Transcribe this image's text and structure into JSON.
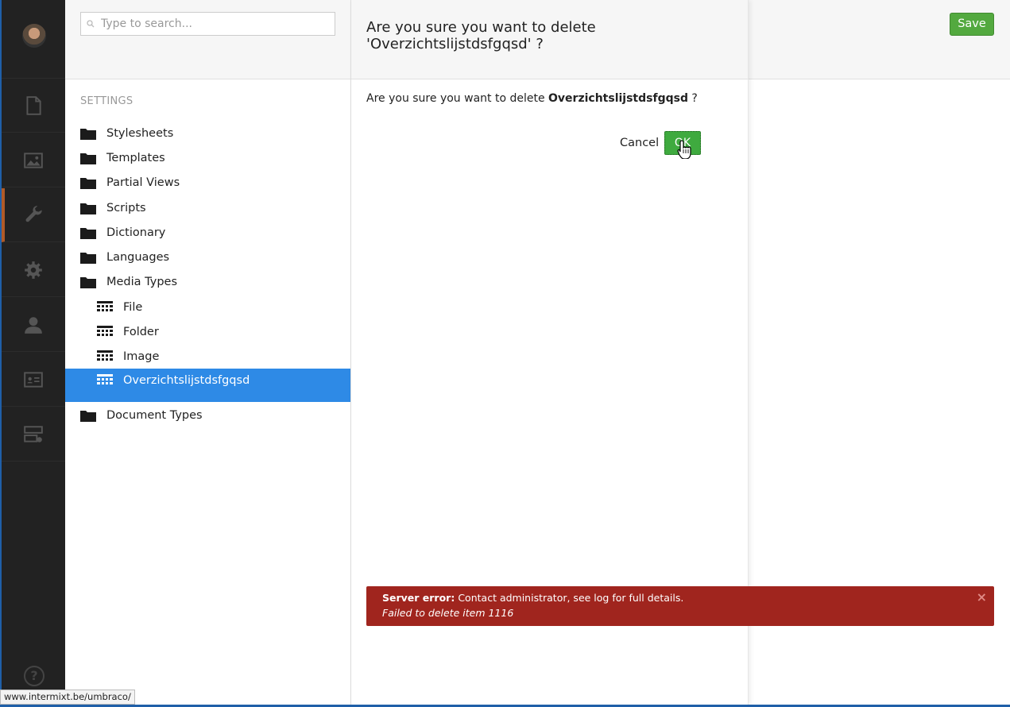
{
  "search": {
    "placeholder": "Type to search..."
  },
  "tree": {
    "section_label": "SETTINGS",
    "items": [
      {
        "label": "Stylesheets",
        "icon": "folder-icon"
      },
      {
        "label": "Templates",
        "icon": "folder-icon"
      },
      {
        "label": "Partial Views",
        "icon": "folder-icon"
      },
      {
        "label": "Scripts",
        "icon": "folder-icon"
      },
      {
        "label": "Dictionary",
        "icon": "folder-icon"
      },
      {
        "label": "Languages",
        "icon": "folder-icon"
      },
      {
        "label": "Media Types",
        "icon": "folder-icon"
      },
      {
        "label": "File",
        "icon": "grid-icon"
      },
      {
        "label": "Folder",
        "icon": "grid-icon"
      },
      {
        "label": "Image",
        "icon": "grid-icon"
      },
      {
        "label": "Overzichtslijstdsfgqsd",
        "icon": "grid-icon",
        "selected": true
      },
      {
        "label": "Document Types",
        "icon": "folder-icon"
      }
    ]
  },
  "dialog": {
    "title": "Are you sure you want to delete 'Overzichtslijstdsfgqsd' ?",
    "body_prefix": "Are you sure you want to delete ",
    "body_item": "Overzichtslijstdsfgqsd",
    "body_suffix": " ?",
    "cancel_label": "Cancel",
    "ok_label": "OK"
  },
  "toolbar": {
    "save_label": "Save"
  },
  "error": {
    "title": "Server error:",
    "message": " Contact administrator, see log for full details.",
    "detail": "Failed to delete item 1116",
    "close": "×"
  },
  "status": {
    "url": "www.intermixt.be/umbraco/"
  },
  "nav": {
    "icons": [
      "content-icon",
      "media-icon",
      "settings-icon",
      "developer-icon",
      "users-icon",
      "members-icon",
      "forms-icon"
    ],
    "help": "?"
  },
  "colors": {
    "accent": "#2e8ae6",
    "success": "#53a93f",
    "danger": "#a0251e"
  }
}
